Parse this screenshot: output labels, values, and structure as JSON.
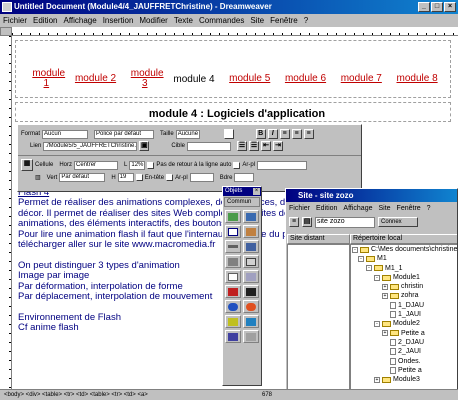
{
  "window": {
    "title": "Untitled Document (Module4/4_JAUFFRETChristine) - Dreamweaver"
  },
  "menu": [
    "Fichier",
    "Edition",
    "Affichage",
    "Insertion",
    "Modifier",
    "Texte",
    "Commandes",
    "Site",
    "Fenêtre",
    "?"
  ],
  "nav": [
    {
      "label": "module 1",
      "current": false
    },
    {
      "label": "module 2",
      "current": false
    },
    {
      "label": "module 3",
      "current": false
    },
    {
      "label": "module 4",
      "current": true
    },
    {
      "label": "module 5",
      "current": false
    },
    {
      "label": "module 6",
      "current": false
    },
    {
      "label": "module 7",
      "current": false
    },
    {
      "label": "module 8",
      "current": false
    }
  ],
  "heading": "module 4 : Logiciels d'application",
  "properties": {
    "format_label": "Format",
    "format_value": "Aucun",
    "font_value": "Police par défaut",
    "size_label": "Taille",
    "size_value": "Aucune",
    "link_label": "Lien",
    "link_value": "./Module5/5_JAUFFRETChristine.ht",
    "target_label": "Cible",
    "cell_label": "Cellule",
    "horz_label": "Horz",
    "horz_value": "Centrer",
    "w_label": "L",
    "w_value": "12%",
    "nowrap_label": "Pas de retour à la ligne auto",
    "bg_label": "Ar-pl",
    "vert_label": "Vert",
    "vert_value": "Par défaut",
    "h_label": "H",
    "h_value": "19",
    "header_label": "En-tête",
    "bg2_label": "Ar-pl",
    "border_label": "Bdre"
  },
  "body": [
    "Flash 4",
    "Permet de réaliser des animations complexes, des interfaces, des éléments de",
    "décor. Il permet de réaliser des sites Web complets, des sites de",
    "animations, des éléments interactifs, des boutons",
    "Pour lire une animation flash il faut que l'internaute dispose du plug-in, le",
    "télécharger aller sur le site www.macromedia.fr",
    "",
    "On peut distinguer 3 types d'animation",
    "Image par image",
    "Par déformation, interpolation de forme",
    "Par déplacement, interpolation de mouvement",
    "",
    "Environnement de Flash",
    "Cf anime flash"
  ],
  "status": "<body> <div> <table> <tr> <td> <table> <tr> <td> <a>",
  "status_right": "678",
  "objets": {
    "title": "Objets",
    "category": "Commun"
  },
  "site": {
    "title": "Site - site zozo",
    "menu": [
      "Fichier",
      "Edition",
      "Affichage",
      "Site",
      "Fenêtre",
      "?"
    ],
    "site_select": "site zozo",
    "connect_label": "Connex",
    "remote_header": "Site distant",
    "local_header": "Répertoire local",
    "tree": [
      {
        "label": "C:\\Mes documents\\christine",
        "type": "folder",
        "indent": 0
      },
      {
        "label": "M1",
        "type": "folder",
        "indent": 1
      },
      {
        "label": "M1_1",
        "type": "folder",
        "indent": 2
      },
      {
        "label": "Module1",
        "type": "folder",
        "indent": 3
      },
      {
        "label": "christin",
        "type": "folder",
        "indent": 4
      },
      {
        "label": "zohra",
        "type": "folder",
        "indent": 4
      },
      {
        "label": "1_DJAU",
        "type": "file",
        "indent": 4
      },
      {
        "label": "1_JAUI",
        "type": "file",
        "indent": 4
      },
      {
        "label": "Module2",
        "type": "folder",
        "indent": 3
      },
      {
        "label": "Petite a",
        "type": "folder",
        "indent": 4
      },
      {
        "label": "2_DJAU",
        "type": "file",
        "indent": 4
      },
      {
        "label": "2_JAUI",
        "type": "file",
        "indent": 4
      },
      {
        "label": "Ondes.",
        "type": "file",
        "indent": 4
      },
      {
        "label": "Petite a",
        "type": "file",
        "indent": 4
      },
      {
        "label": "Module3",
        "type": "folder",
        "indent": 3
      }
    ]
  }
}
